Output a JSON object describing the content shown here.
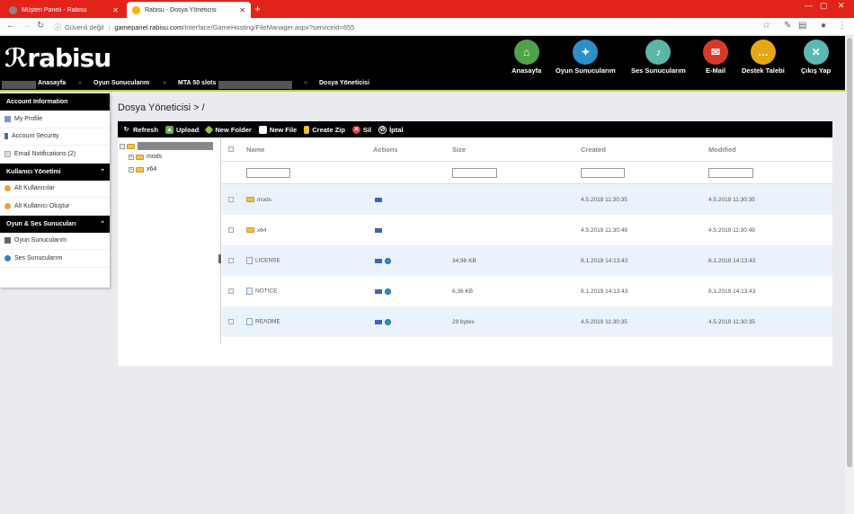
{
  "browser": {
    "tabs": [
      {
        "title": "Müşteri Paneli - Rabisu",
        "active": false
      },
      {
        "title": "Rabisu - Dosya Yöneticisi",
        "active": true
      }
    ],
    "security_label": "Güvenli değil",
    "url_host": "gamepanel.rabisu.com",
    "url_path": "/Interface/GameHosting/FileManager.aspx?serviceid=655"
  },
  "header": {
    "logo": "rabisu",
    "nav": [
      {
        "label": "Anasayfa",
        "icon": "home-icon",
        "color": "#4fa24a"
      },
      {
        "label": "Oyun Sunucularım",
        "icon": "gamepad-icon",
        "color": "#2e8fc7"
      },
      {
        "label": "Ses Sunucularım",
        "icon": "microphone-icon",
        "color": "#5bb6a6"
      },
      {
        "label": "E-Mail",
        "icon": "envelope-icon",
        "color": "#d9392b"
      },
      {
        "label": "Destek Talebi",
        "icon": "chat-icon",
        "color": "#e6a817"
      },
      {
        "label": "Çıkış Yap",
        "icon": "close-icon",
        "color": "#5cb8b2"
      }
    ]
  },
  "breadcrumb": {
    "items": [
      "Anasayfa",
      "Oyun Sunucularım",
      "MTA 50 slots",
      "Dosya Yöneticisi"
    ]
  },
  "sidebar": {
    "sections": [
      {
        "title": "Account Information",
        "items": [
          "My Profile",
          "Account Security",
          "Email Notifications (2)"
        ]
      },
      {
        "title": "Kullanıcı Yönetimi",
        "items": [
          "Alt Kullanıcılar",
          "Alt Kullanıcı Oluştur"
        ]
      },
      {
        "title": "Oyun & Ses Sunucuları",
        "items": [
          "Oyun Sunucularım",
          "Ses Sunucularım"
        ]
      }
    ]
  },
  "page": {
    "title": "Dosya Yöneticisi > /"
  },
  "toolbar": {
    "buttons": [
      "Refresh",
      "Upload",
      "New Folder",
      "New File",
      "Create Zip",
      "Sil",
      "İptal"
    ]
  },
  "tree": {
    "children": [
      "mods",
      "x64"
    ]
  },
  "grid": {
    "columns": [
      "Name",
      "Actions",
      "Size",
      "Created",
      "Modified"
    ],
    "rows": [
      {
        "name": "mods",
        "type": "folder",
        "size": "",
        "created": "4.5.2019 11:30:35",
        "modified": "4.5.2019 11:30:35"
      },
      {
        "name": "x64",
        "type": "folder",
        "size": "",
        "created": "4.5.2019 11:30:49",
        "modified": "4.5.2019 11:30:49"
      },
      {
        "name": "LICENSE",
        "type": "file",
        "size": "34,98 KB",
        "created": "8.1.2019 14:13:43",
        "modified": "8.1.2019 14:13:43"
      },
      {
        "name": "NOTICE",
        "type": "file",
        "size": "6,36 KB",
        "created": "8.1.2019 14:13:43",
        "modified": "8.1.2019 14:13:43"
      },
      {
        "name": "README",
        "type": "file",
        "size": "29 bytes",
        "created": "4.5.2019 11:30:35",
        "modified": "4.5.2019 11:30:35"
      }
    ]
  },
  "colors": {
    "tabbar": "#e2231a",
    "accent_line": "#b9d24a",
    "row_alt": "#eaf2fb"
  }
}
